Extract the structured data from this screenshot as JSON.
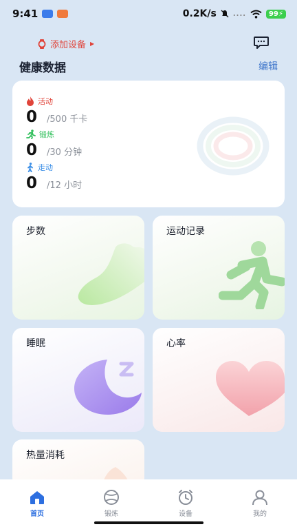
{
  "status_bar": {
    "time": "9:41",
    "network_speed": "0.2K/s",
    "signal_dots": "....",
    "battery": "99"
  },
  "header": {
    "add_device": "添加设备",
    "title": "健康数据",
    "edit": "编辑"
  },
  "summary": {
    "metrics": [
      {
        "label": "活动",
        "value": "0",
        "goal": "/500 千卡",
        "color": "#e0443a",
        "icon": "flame-icon"
      },
      {
        "label": "锻炼",
        "value": "0",
        "goal": "/30 分钟",
        "color": "#2fbf5a",
        "icon": "runner-icon"
      },
      {
        "label": "走动",
        "value": "0",
        "goal": "/12 小时",
        "color": "#3a8ee6",
        "icon": "walker-icon"
      }
    ]
  },
  "tiles": {
    "steps": "步数",
    "records": "运动记录",
    "sleep": "睡眠",
    "heart": "心率",
    "calories": "热量消耗"
  },
  "tabbar": {
    "items": [
      {
        "label": "首页",
        "icon": "home-icon",
        "active": true
      },
      {
        "label": "锻炼",
        "icon": "ball-icon",
        "active": false
      },
      {
        "label": "设备",
        "icon": "watch-icon",
        "active": false
      },
      {
        "label": "我的",
        "icon": "user-icon",
        "active": false
      }
    ]
  },
  "colors": {
    "background": "#d9e6f4",
    "accent": "#2d6fe0",
    "alert": "#e0443a"
  }
}
